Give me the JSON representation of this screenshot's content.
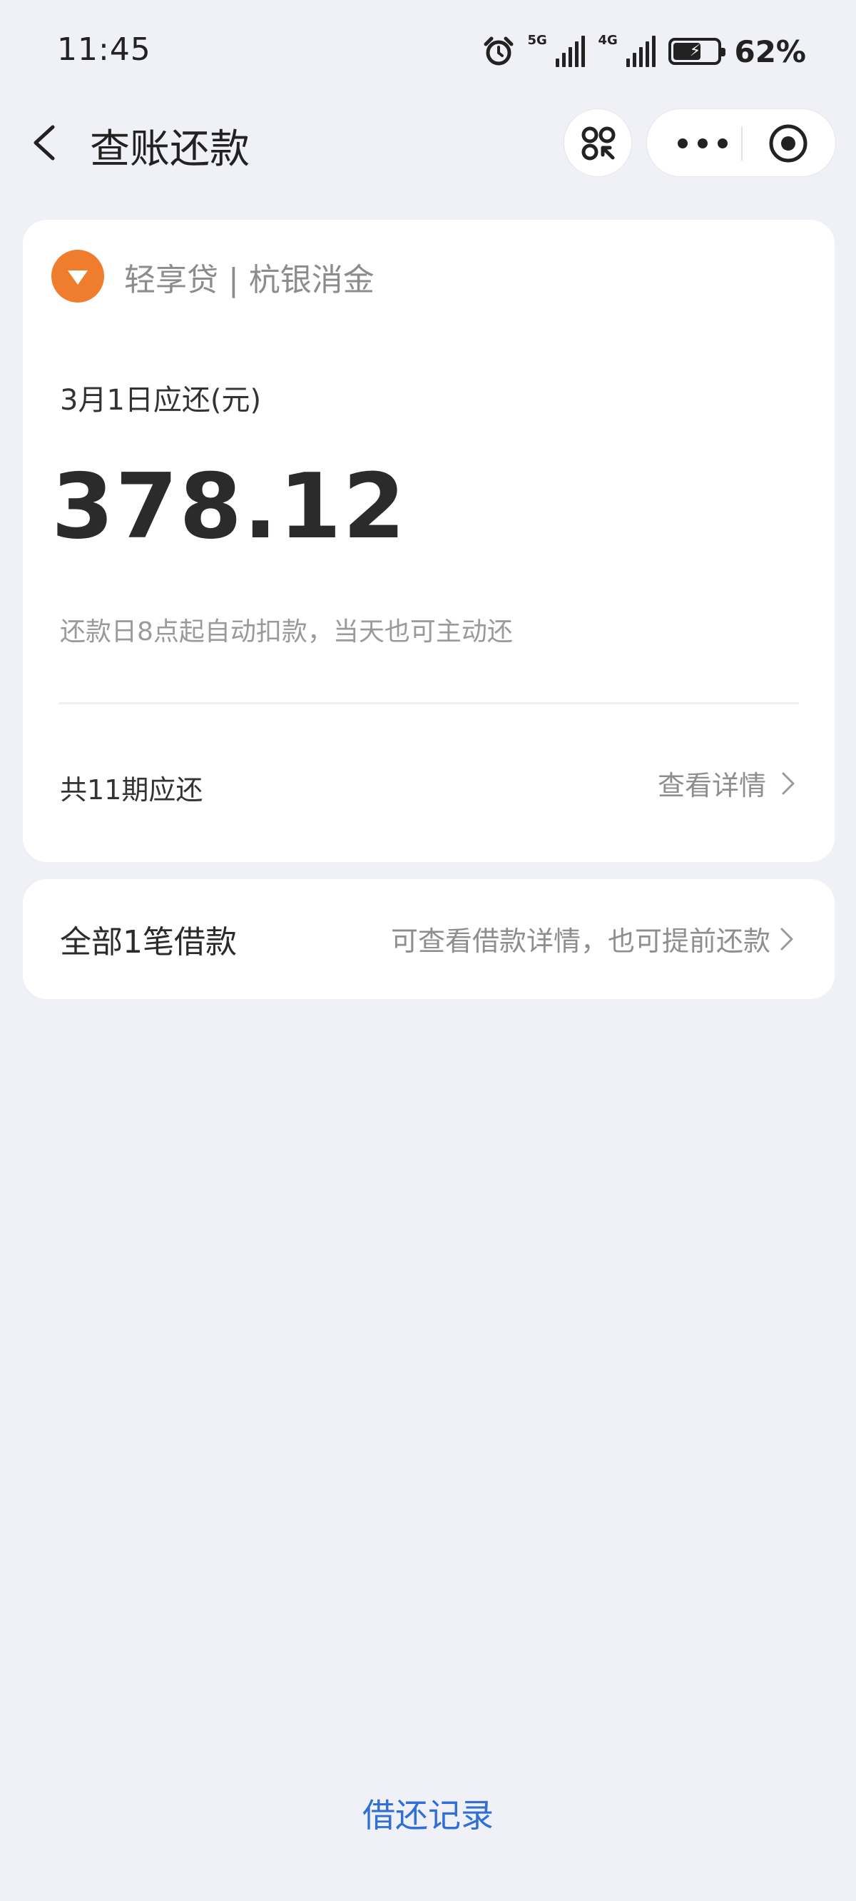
{
  "status_bar": {
    "time": "11:45",
    "signal_1_label": "5G",
    "signal_2_label": "4G",
    "battery_percent": "62%",
    "battery_level": 0.62
  },
  "nav": {
    "title": "查账还款"
  },
  "bill": {
    "brand": "轻享贷 | 杭银消金",
    "due_label": "3月1日应还(元)",
    "amount": "378.12",
    "auto_note": "还款日8点起自动扣款，当天也可主动还",
    "periods": "共11期应还",
    "detail_link": "查看详情"
  },
  "loans": {
    "title": "全部1笔借款",
    "hint": "可查看借款详情，也可提前还款"
  },
  "footer": {
    "records_link": "借还记录"
  },
  "colors": {
    "background": "#f0f1f6",
    "brand_orange": "#f07c2d",
    "link_blue": "#2f6fd6"
  }
}
